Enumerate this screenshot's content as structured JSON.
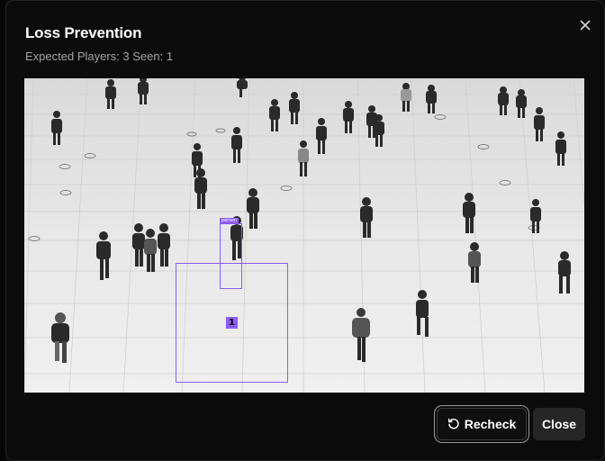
{
  "dialog": {
    "title": "Loss Prevention",
    "subtitle": "Expected Players: 3 Seen: 1"
  },
  "detections": [
    {
      "label": "person"
    }
  ],
  "zones": [
    {
      "tag": "1"
    }
  ],
  "buttons": {
    "recheck_label": "Recheck",
    "close_label": "Close"
  },
  "colors": {
    "accent": "#8b5cf6",
    "background": "#0b0b0b",
    "secondary_button": "#262626"
  },
  "icons": {
    "close": "close-icon",
    "recheck": "refresh-icon"
  }
}
